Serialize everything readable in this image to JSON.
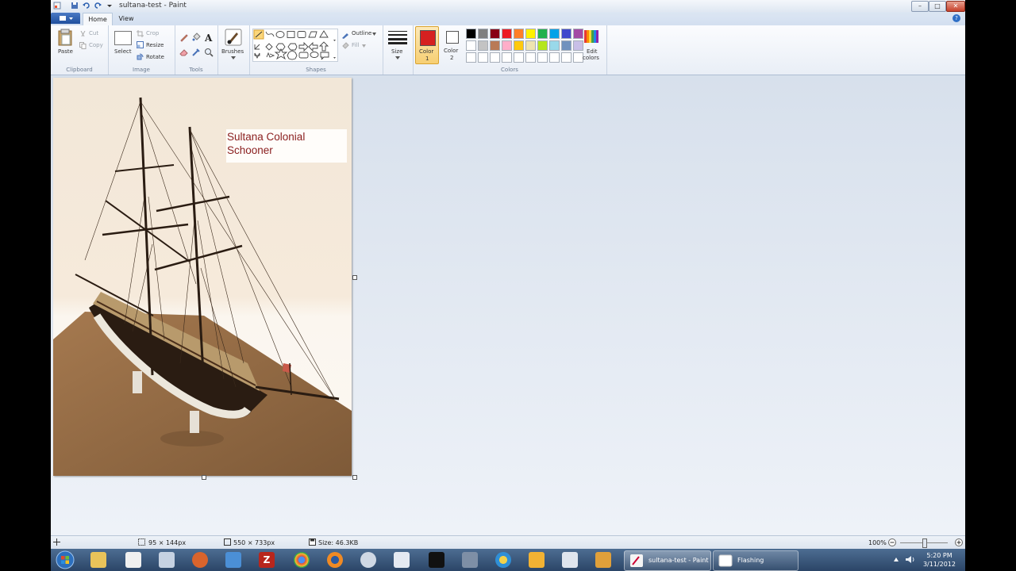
{
  "window": {
    "title": "sultana-test - Paint",
    "controls": {
      "minimize": "–",
      "maximize": "□",
      "close": "✕"
    }
  },
  "tabs": {
    "file": "▾",
    "home": "Home",
    "view": "View"
  },
  "help": "?",
  "ribbon": {
    "clipboard": {
      "label": "Clipboard",
      "paste": "Paste",
      "cut": "Cut",
      "copy": "Copy"
    },
    "image": {
      "label": "Image",
      "select": "Select",
      "crop": "Crop",
      "resize": "Resize",
      "rotate": "Rotate"
    },
    "tools": {
      "label": "Tools"
    },
    "brushes": {
      "label": "Brushes"
    },
    "shapes": {
      "label": "Shapes",
      "outline": "Outline",
      "fill": "Fill"
    },
    "size": {
      "label": "Size"
    },
    "colors": {
      "label": "Colors",
      "color1_label": "Color",
      "color1_num": "1",
      "color2_label": "Color",
      "color2_num": "2",
      "color1": "#d62020",
      "color2": "#ffffff",
      "edit_label": "Edit",
      "edit_label2": "colors",
      "palette_row1": [
        "#000000",
        "#7f7f7f",
        "#880015",
        "#ed1c24",
        "#ff7f27",
        "#fff200",
        "#22b14c",
        "#00a2e8",
        "#3f48cc",
        "#a349a4"
      ],
      "palette_row2": [
        "#ffffff",
        "#c3c3c3",
        "#b97a57",
        "#ffaec9",
        "#ffc90e",
        "#efe4b0",
        "#b5e61d",
        "#99d9ea",
        "#7092be",
        "#c8bfe7"
      ]
    }
  },
  "canvas": {
    "caption_line1": "Sultana Colonial",
    "caption_line2": "Schooner"
  },
  "status": {
    "cursor_pos": "95 × 144px",
    "selection_size": "550 × 733px",
    "file_size": "Size: 46.3KB",
    "zoom": "100%"
  },
  "taskbar": {
    "active_window": "sultana-test - Paint",
    "other_window": "Flashing",
    "time": "5:20 PM",
    "date": "3/11/2012"
  }
}
